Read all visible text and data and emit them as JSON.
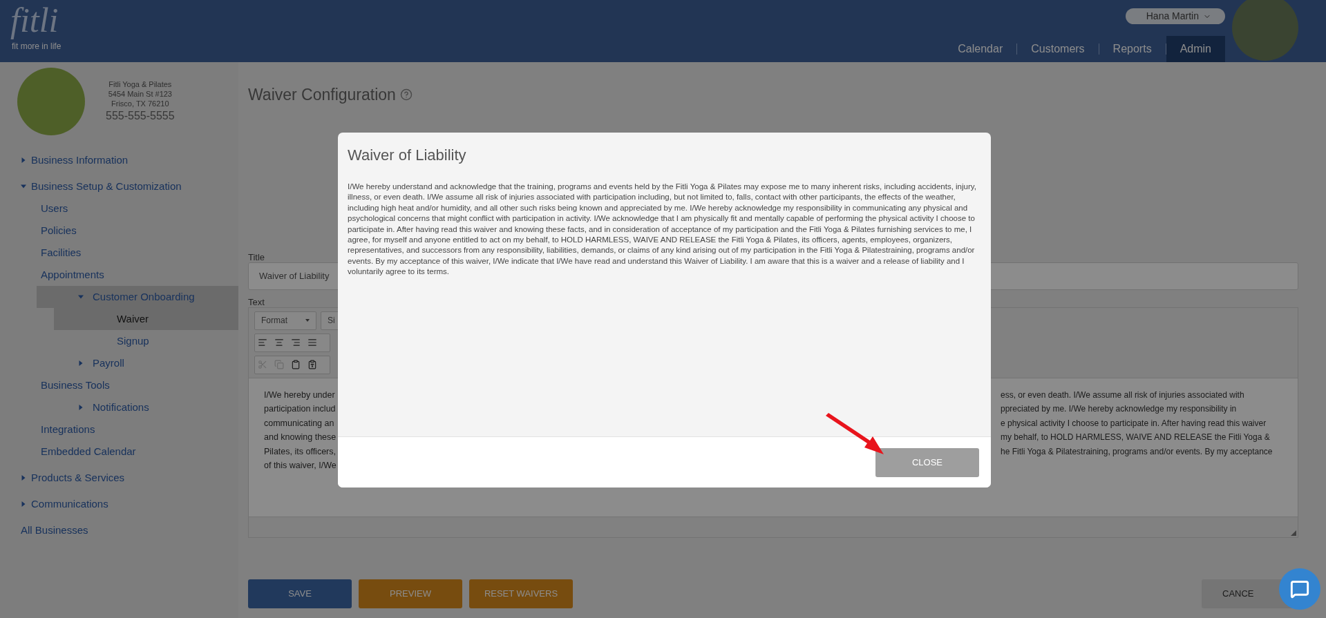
{
  "header": {
    "logo": {
      "wordmark": "fitli",
      "tagline": "fit more in life"
    },
    "user": {
      "name": "Hana Martin"
    },
    "tabs": [
      {
        "label": "Calendar",
        "selected": false
      },
      {
        "label": "Customers",
        "selected": false
      },
      {
        "label": "Reports",
        "selected": false
      },
      {
        "label": "Admin",
        "selected": true
      }
    ]
  },
  "sidebar": {
    "business": {
      "name": "Fitli Yoga & Pilates",
      "address_line_1": "5454 Main St #123",
      "address_line_2": "Frisco, TX 76210",
      "phone": "555-555-5555"
    },
    "items": [
      {
        "label": "Business Information",
        "expanded": false,
        "selected": false
      },
      {
        "label": "Business Setup & Customization",
        "expanded": true,
        "selected": false,
        "children": [
          {
            "label": "Users",
            "selected": false
          },
          {
            "label": "Policies",
            "selected": false
          },
          {
            "label": "Facilities",
            "selected": false
          },
          {
            "label": "Appointments",
            "selected": false
          },
          {
            "label": "Customer Onboarding",
            "expanded": true,
            "selected": true,
            "children": [
              {
                "label": "Waiver",
                "selected": true
              },
              {
                "label": "Signup",
                "selected": false
              }
            ]
          },
          {
            "label": "Payroll",
            "expanded": false,
            "selected": false
          },
          {
            "label": "Business Tools",
            "selected": false
          },
          {
            "label": "Notifications",
            "expanded": false,
            "selected": false
          },
          {
            "label": "Integrations",
            "selected": false
          },
          {
            "label": "Embedded Calendar",
            "selected": false
          }
        ]
      },
      {
        "label": "Products & Services",
        "expanded": false,
        "selected": false
      },
      {
        "label": "Communications",
        "expanded": false,
        "selected": false
      },
      {
        "label": "All Businesses",
        "selected": false
      }
    ]
  },
  "main": {
    "heading": "Waiver Configuration",
    "title_label": "Title",
    "title_value": "Waiver of Liability",
    "text_label": "Text",
    "toolbar": {
      "dropdowns": [
        "Format",
        "Si"
      ],
      "rows": [
        [
          {
            "kind": "align-left",
            "disabled": false
          },
          {
            "kind": "align-center",
            "disabled": false
          },
          {
            "kind": "align-right",
            "disabled": false
          },
          {
            "kind": "align-justify",
            "disabled": false
          }
        ],
        [
          {
            "kind": "cut",
            "disabled": true
          },
          {
            "kind": "copy",
            "disabled": true
          },
          {
            "kind": "paste",
            "disabled": false
          },
          {
            "kind": "paste-text",
            "disabled": false
          }
        ]
      ]
    },
    "editor_text_left": [
      "I/We hereby under",
      "participation includ",
      "communicating an",
      "and knowing these",
      "Pilates, its officers,",
      "of this waiver, I/We"
    ],
    "editor_text_right": [
      "ess, or even death. I/We assume all risk of injuries associated with",
      "ppreciated by me. I/We hereby acknowledge my responsibility in",
      "e physical activity I choose to participate in. After having read this waiver",
      "my behalf, to HOLD HARMLESS, WAIVE AND RELEASE the Fitli Yoga &",
      "he Fitli Yoga & Pilatestraining, programs and/or events. By my acceptance"
    ],
    "buttons": [
      {
        "label": "SAVE",
        "kind": "primary"
      },
      {
        "label": "PREVIEW",
        "kind": "warning"
      },
      {
        "label": "RESET WAIVERS",
        "kind": "warning"
      }
    ],
    "cancel_label": "CANCE"
  },
  "modal": {
    "title": "Waiver of Liability",
    "body": "I/We hereby understand and acknowledge that the training, programs and events held by the Fitli Yoga & Pilates may expose me to many inherent risks, including accidents, injury, illness, or even death. I/We assume all risk of injuries associated with participation including, but not limited to, falls, contact with other participants, the effects of the weather, including high heat and/or humidity, and all other such risks being known and appreciated by me. I/We hereby acknowledge my responsibility in communicating any physical and psychological concerns that might conflict with participation in activity. I/We acknowledge that I am physically fit and mentally capable of performing the physical activity I choose to participate in. After having read this waiver and knowing these facts, and in consideration of acceptance of my participation and the Fitli Yoga & Pilates furnishing services to me, I agree, for myself and anyone entitled to act on my behalf, to HOLD HARMLESS, WAIVE AND RELEASE the Fitli Yoga & Pilates, its officers, agents, employees, organizers, representatives, and successors from any responsibility, liabilities, demands, or claims of any kind arising out of my participation in the Fitli Yoga & Pilatestraining, programs and/or events. By my acceptance of this waiver, I/We indicate that I/We have read and understand this Waiver of Liability. I am aware that this is a waiver and a release of liability and I voluntarily agree to its terms.",
    "close_label": "CLOSE"
  }
}
